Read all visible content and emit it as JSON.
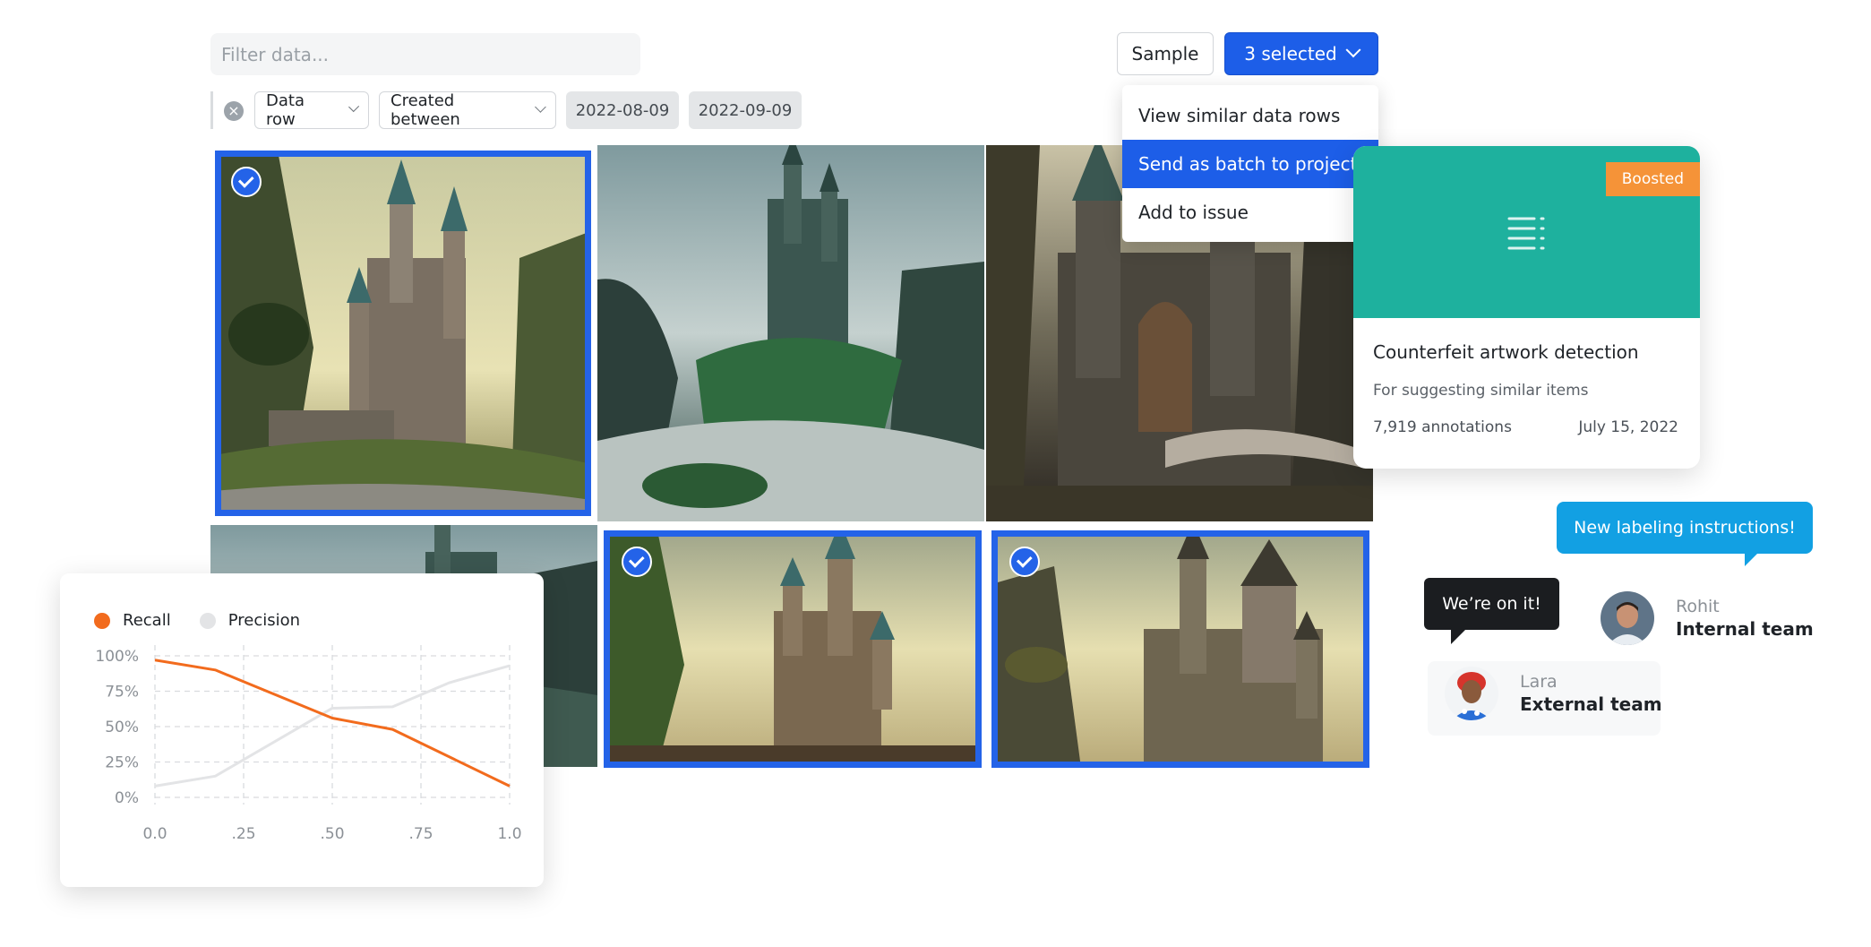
{
  "filter": {
    "placeholder": "Filter data..."
  },
  "toolbar": {
    "sample_label": "Sample",
    "selected_label": "3 selected"
  },
  "chips": {
    "field": "Data row",
    "operator": "Created between",
    "date_from": "2022-08-09",
    "date_to": "2022-09-09"
  },
  "menu": {
    "items": [
      {
        "label": "View similar data rows"
      },
      {
        "label": "Send as batch to project"
      },
      {
        "label": "Add to issue"
      }
    ]
  },
  "grid": {
    "tiles": [
      {
        "name": "castle-image-1",
        "selected": true
      },
      {
        "name": "castle-image-2",
        "selected": false
      },
      {
        "name": "castle-image-3",
        "selected": false
      },
      {
        "name": "castle-image-4",
        "selected": false
      },
      {
        "name": "castle-image-5",
        "selected": true
      },
      {
        "name": "castle-image-6",
        "selected": true
      }
    ]
  },
  "card": {
    "badge": "Boosted",
    "title": "Counterfeit artwork detection",
    "subtitle": "For suggesting similar items",
    "annotations": "7,919 annotations",
    "date": "July 15, 2022",
    "accent": "#1eb19e",
    "badge_color": "#f59338"
  },
  "chat": {
    "message_blue": "New labeling instructions!",
    "message_dark": "We’re on it!",
    "users": [
      {
        "name": "Rohit",
        "team": "Internal team"
      },
      {
        "name": "Lara",
        "team": "External team"
      }
    ]
  },
  "colors": {
    "accent": "#1d5ee8",
    "selection": "#2463e8",
    "chat_blue": "#12a0e3"
  },
  "chart_data": {
    "type": "line",
    "xlabel": "",
    "ylabel": "",
    "x": [
      0.0,
      0.17,
      0.5,
      0.67,
      1.0
    ],
    "xticks": [
      "0.0",
      ".25",
      ".50",
      ".75",
      "1.0"
    ],
    "yticks": [
      "100%",
      "75%",
      "50%",
      "25%",
      "0%"
    ],
    "xlim": [
      0,
      1
    ],
    "ylim": [
      0,
      1
    ],
    "legend_position": "top-left",
    "grid": true,
    "series": [
      {
        "name": "Recall",
        "color": "#f26b1d",
        "x": [
          0.0,
          0.17,
          0.5,
          0.67,
          1.0
        ],
        "y": [
          0.97,
          0.9,
          0.56,
          0.48,
          0.08
        ]
      },
      {
        "name": "Precision",
        "color": "#e3e4e6",
        "x": [
          0.0,
          0.17,
          0.5,
          0.67,
          0.83,
          1.0
        ],
        "y": [
          0.08,
          0.15,
          0.63,
          0.64,
          0.81,
          0.93
        ]
      }
    ]
  }
}
